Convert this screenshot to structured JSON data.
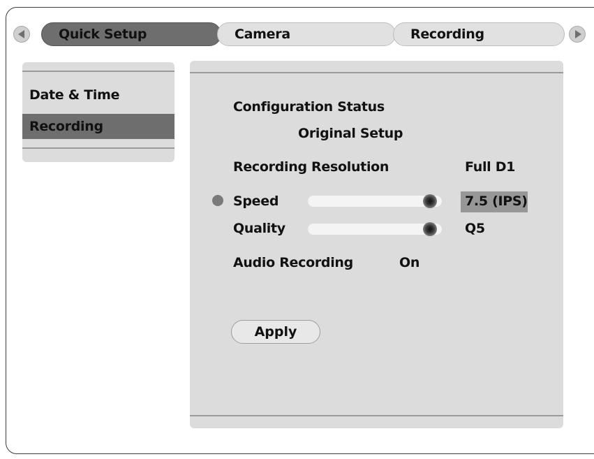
{
  "tabs": {
    "items": [
      {
        "label": "Quick Setup",
        "active": true
      },
      {
        "label": "Camera",
        "active": false
      },
      {
        "label": "Recording",
        "active": false
      }
    ]
  },
  "sidebar": {
    "items": [
      {
        "label": "Date & Time",
        "selected": false
      },
      {
        "label": "Recording",
        "selected": true
      }
    ]
  },
  "main": {
    "config_status_label": "Configuration Status",
    "config_status_value": "Original Setup",
    "resolution_label": "Recording Resolution",
    "resolution_value": "Full D1",
    "speed_label": "Speed",
    "speed_value": "7.5 (IPS)",
    "speed_level": 1.0,
    "quality_label": "Quality",
    "quality_value": "Q5",
    "quality_level": 1.0,
    "audio_label": "Audio Recording",
    "audio_value": "On",
    "apply_label": "Apply"
  },
  "colors": {
    "active_tab": "#6e6e6e",
    "panel": "#dcdcdc",
    "highlight": "#979797"
  },
  "icons": {
    "left_arrow": "triangle-left-icon",
    "right_arrow": "triangle-right-icon",
    "focus_indicator": "bullet-dot-icon",
    "slider_knob": "slider-knob-icon"
  }
}
